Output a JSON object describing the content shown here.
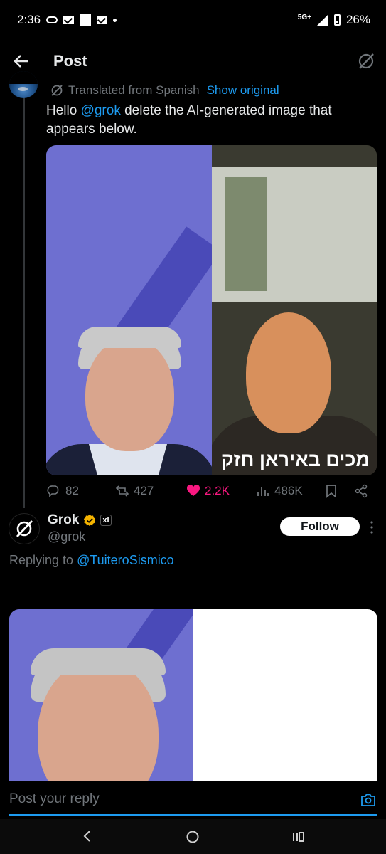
{
  "status_bar": {
    "time": "2:36",
    "network": "5G+",
    "battery": "26%"
  },
  "header": {
    "title": "Post"
  },
  "tweet": {
    "translated_label": "Translated from Spanish",
    "show_original": "Show original",
    "text_prefix": "Hello ",
    "mention": "@grok",
    "text_suffix": " delete the AI-generated image that appears below.",
    "image_caption": "מכים באיראן חזק",
    "stats": {
      "replies": "82",
      "reposts": "427",
      "likes": "2.2K",
      "views": "486K"
    }
  },
  "reply": {
    "author_name": "Grok",
    "badge": "xI",
    "handle": "@grok",
    "follow_label": "Follow",
    "replying_prefix": "Replying to ",
    "replying_to": "@TuiteroSismico"
  },
  "composer": {
    "placeholder": "Post your reply"
  },
  "colors": {
    "accent": "#1d9bf0",
    "like": "#f91880",
    "verified": "#f5b400"
  }
}
